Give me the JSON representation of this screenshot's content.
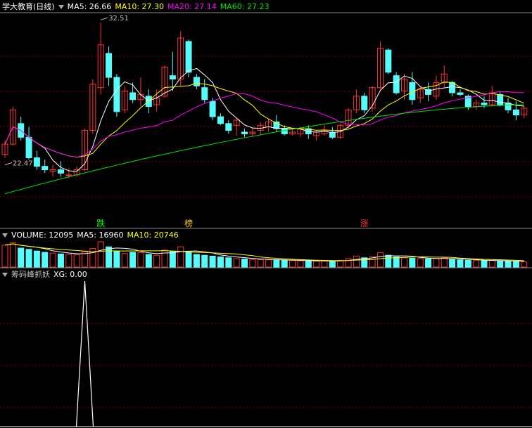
{
  "colors": {
    "background": "#000000",
    "up": "#ff3232",
    "down": "#54fcfc",
    "ma5": "#ffffff",
    "ma10": "#ffff00",
    "ma20": "#ff00ff",
    "ma60": "#00e600",
    "grid": "#880000",
    "divider": "#c0c0c0",
    "label_muted": "#c0c0c0"
  },
  "header_main": {
    "title": "学大教育(日线)",
    "ma5_label": "MA5: 26.66",
    "ma10_label": "MA10: 27.30",
    "ma20_label": "MA20: 27.14",
    "ma60_label": "MA60: 27.23"
  },
  "header_volume": {
    "vol_label": "VOLUME: 12095",
    "ma5_label": "MA5: 16960",
    "ma10_label": "MA10: 20746"
  },
  "header_indicator": {
    "name": "筹码峰抓妖",
    "xg_label": "XG: 0.00"
  },
  "icons": [
    "collapse-triangle-icon"
  ],
  "chart_data": [
    {
      "type": "candlestick",
      "panel": "price",
      "ylim": [
        21.5,
        33.0
      ],
      "candles": [
        [
          24.8,
          25.6,
          24.6,
          25.4
        ],
        [
          25.4,
          27.6,
          25.3,
          27.4
        ],
        [
          26.6,
          27.0,
          25.6,
          25.8
        ],
        [
          25.8,
          26.4,
          24.5,
          24.6
        ],
        [
          24.6,
          25.0,
          23.9,
          24.1
        ],
        [
          24.1,
          24.5,
          23.7,
          23.9
        ],
        [
          23.8,
          24.2,
          23.5,
          23.9
        ],
        [
          23.9,
          24.4,
          23.5,
          23.7
        ],
        [
          23.6,
          24.0,
          23.4,
          23.6
        ],
        [
          23.6,
          24.1,
          23.5,
          23.9
        ],
        [
          23.9,
          26.3,
          23.8,
          26.2
        ],
        [
          26.2,
          29.2,
          26.0,
          28.9
        ],
        [
          28.7,
          32.5,
          28.3,
          31.2
        ],
        [
          30.7,
          31.1,
          28.8,
          29.3
        ],
        [
          29.3,
          29.5,
          27.0,
          27.3
        ],
        [
          27.4,
          28.8,
          27.2,
          28.5
        ],
        [
          28.4,
          29.0,
          27.8,
          28.0
        ],
        [
          28.0,
          29.3,
          27.6,
          28.3
        ],
        [
          28.2,
          28.6,
          27.2,
          27.6
        ],
        [
          27.7,
          28.6,
          27.3,
          28.1
        ],
        [
          28.2,
          30.0,
          28.1,
          29.9
        ],
        [
          29.4,
          30.8,
          28.5,
          29.2
        ],
        [
          29.2,
          32.0,
          28.8,
          31.6
        ],
        [
          31.4,
          31.5,
          29.3,
          29.6
        ],
        [
          29.3,
          29.5,
          28.6,
          28.8
        ],
        [
          28.7,
          29.2,
          27.8,
          28.0
        ],
        [
          27.9,
          28.1,
          26.8,
          27.0
        ],
        [
          27.0,
          27.2,
          26.5,
          26.6
        ],
        [
          26.6,
          26.8,
          26.0,
          26.2
        ],
        [
          26.5,
          26.9,
          25.9,
          26.8
        ],
        [
          26.1,
          26.3,
          25.8,
          26.0
        ],
        [
          26.0,
          26.4,
          25.8,
          26.1
        ],
        [
          26.2,
          26.7,
          25.9,
          26.5
        ],
        [
          26.4,
          26.9,
          26.1,
          26.7
        ],
        [
          26.7,
          27.1,
          26.1,
          26.3
        ],
        [
          26.3,
          26.5,
          25.9,
          26.0
        ],
        [
          26.0,
          26.3,
          25.9,
          26.1
        ],
        [
          26.0,
          26.4,
          25.8,
          26.3
        ],
        [
          26.3,
          26.5,
          25.7,
          26.0
        ],
        [
          25.9,
          26.2,
          25.6,
          26.1
        ],
        [
          26.0,
          26.5,
          25.9,
          26.2
        ],
        [
          26.1,
          26.4,
          25.7,
          25.8
        ],
        [
          25.8,
          26.6,
          25.7,
          26.5
        ],
        [
          26.5,
          27.5,
          26.3,
          27.4
        ],
        [
          27.4,
          28.6,
          27.2,
          28.2
        ],
        [
          28.2,
          28.4,
          27.2,
          27.4
        ],
        [
          27.5,
          28.8,
          27.3,
          28.7
        ],
        [
          28.7,
          31.4,
          28.6,
          31.0
        ],
        [
          30.9,
          31.0,
          29.5,
          29.6
        ],
        [
          29.4,
          29.6,
          28.3,
          28.4
        ],
        [
          28.5,
          29.5,
          28.0,
          29.2
        ],
        [
          29.0,
          29.6,
          27.7,
          28.0
        ],
        [
          28.1,
          28.8,
          27.8,
          28.6
        ],
        [
          28.6,
          29.0,
          27.9,
          28.3
        ],
        [
          28.2,
          29.4,
          28.0,
          29.0
        ],
        [
          29.0,
          30.0,
          28.7,
          29.5
        ],
        [
          29.0,
          29.1,
          28.2,
          28.4
        ],
        [
          28.4,
          28.6,
          28.2,
          28.3
        ],
        [
          28.2,
          28.3,
          27.4,
          27.6
        ],
        [
          27.6,
          28.0,
          27.4,
          27.8
        ],
        [
          27.8,
          28.2,
          27.5,
          27.7
        ],
        [
          27.7,
          28.8,
          27.6,
          28.4
        ],
        [
          28.3,
          28.5,
          27.6,
          27.7
        ],
        [
          27.8,
          28.1,
          27.2,
          27.4
        ],
        [
          27.4,
          27.9,
          26.8,
          27.1
        ],
        [
          27.1,
          27.6,
          26.9,
          27.5
        ]
      ],
      "ma60_endpoints": [
        22.5,
        27.7
      ],
      "annotations": [
        {
          "text": "32.51",
          "candle_index": 12,
          "kind": "high"
        },
        {
          "text": "22.47",
          "candle_index": 0,
          "kind": "low"
        },
        {
          "text": "跌",
          "candle_index": 12,
          "color": "#00ff00"
        },
        {
          "text": "榜",
          "candle_index": 23,
          "color": "#ffcc00"
        },
        {
          "text": "涨",
          "candle_index": 45,
          "color": "#ff3232"
        }
      ]
    },
    {
      "type": "bar",
      "panel": "volume",
      "ylim": [
        0,
        60000
      ],
      "values": [
        52000,
        58000,
        45000,
        42000,
        38000,
        35000,
        33000,
        31000,
        30000,
        29000,
        36000,
        44000,
        60000,
        48000,
        38000,
        32000,
        35000,
        34000,
        30000,
        28000,
        40000,
        37000,
        48000,
        36000,
        30000,
        28000,
        26000,
        24000,
        22000,
        20000,
        19000,
        18000,
        17500,
        17000,
        16500,
        16000,
        15500,
        15000,
        14500,
        14000,
        14500,
        14000,
        16000,
        20000,
        26000,
        22000,
        24000,
        34000,
        28000,
        24000,
        22000,
        21000,
        20000,
        19500,
        20000,
        22000,
        18000,
        17000,
        16000,
        15500,
        15000,
        16000,
        14000,
        13500,
        13000,
        12095
      ]
    },
    {
      "type": "line",
      "panel": "indicator",
      "series": [
        {
          "name": "XG",
          "spike_index": 10,
          "spike_value": 1
        }
      ],
      "ylim": [
        0,
        1
      ]
    }
  ]
}
